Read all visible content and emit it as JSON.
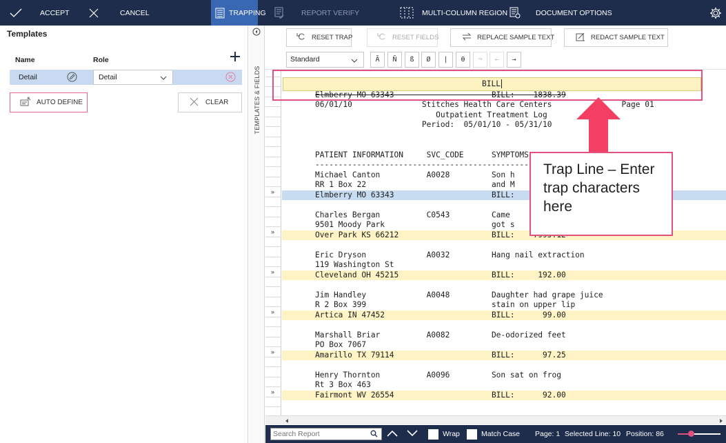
{
  "toolbar": {
    "accept": "ACCEPT",
    "cancel": "CANCEL",
    "trapping": "TRAPPING",
    "report_verify": "REPORT VERIFY",
    "multi_column": "MULTI-COLUMN REGION",
    "document_options": "DOCUMENT OPTIONS"
  },
  "templates": {
    "title": "Templates",
    "name_header": "Name",
    "role_header": "Role",
    "row": {
      "name": "Detail",
      "role": "Detail"
    },
    "auto_define": "AUTO DEFINE",
    "clear": "CLEAR",
    "side_tab": "TEMPLATES & FIELDS"
  },
  "trap_tools": {
    "reset_trap": "RESET TRAP",
    "reset_fields": "RESET FIELDS",
    "replace_sample": "REPLACE SAMPLE TEXT",
    "redact_sample": "REDACT SAMPLE TEXT",
    "font": "Standard",
    "chars": [
      "Ã",
      "Ñ",
      "ß",
      "Ø",
      "|",
      "θ",
      "¬",
      "←",
      "→"
    ]
  },
  "trap": {
    "value": "BILL",
    "tooltip": "Trap Line – Enter trap characters here"
  },
  "report": {
    "markers": [
      {
        "row": 11,
        "sym": "»"
      },
      {
        "row": 15,
        "sym": "»"
      },
      {
        "row": 19,
        "sym": "»"
      },
      {
        "row": 23,
        "sym": "»"
      },
      {
        "row": 27,
        "sym": "»"
      },
      {
        "row": 31,
        "sym": "»"
      }
    ],
    "lines": [
      {
        "row": 2,
        "text": "Elmberry MO 63343                     BILL:    1838.39",
        "strike": true
      },
      {
        "row": 3,
        "text": "06/01/10               Stitches Health Care Centers               Page 01"
      },
      {
        "row": 4,
        "text": "                          Outpatient Treatment Log"
      },
      {
        "row": 5,
        "text": "                       Period:  05/01/10 - 05/31/10"
      },
      {
        "row": 8,
        "text": "PATIENT INFORMATION     SVC_CODE      SYMPTOMS                       "
      },
      {
        "row": 9,
        "text": "------------------------------------------------------------------------"
      },
      {
        "row": 10,
        "text": "Michael Canton          A0028         Son h"
      },
      {
        "row": 11,
        "text": "RR 1 Box 22                           and M"
      },
      {
        "row": 12,
        "text": "Elmberry MO 63343                     BILL:"
      },
      {
        "row": 14,
        "text": "Charles Bergan          C0543         Came"
      },
      {
        "row": 15,
        "text": "9501 Moody Park                       got s"
      },
      {
        "row": 16,
        "text": "Over Park KS 66212                    BILL:    7995.12"
      },
      {
        "row": 18,
        "text": "Eric Dryson             A0032         Hang nail extraction"
      },
      {
        "row": 19,
        "text": "119 Washington St"
      },
      {
        "row": 20,
        "text": "Cleveland OH 45215                    BILL:     192.00"
      },
      {
        "row": 22,
        "text": "Jim Handley             A0048         Daughter had grape juice"
      },
      {
        "row": 23,
        "text": "R 2 Box 399                           stain on upper lip"
      },
      {
        "row": 24,
        "text": "Artica IN 47452                       BILL:      99.00"
      },
      {
        "row": 26,
        "text": "Marshall Briar          A0082         De-odorized feet"
      },
      {
        "row": 27,
        "text": "PO Box 7067"
      },
      {
        "row": 28,
        "text": "Amarillo TX 79114                     BILL:      97.25"
      },
      {
        "row": 30,
        "text": "Henry Thornton          A0096         Son sat on frog"
      },
      {
        "row": 31,
        "text": "Rt 3 Box 463"
      },
      {
        "row": 32,
        "text": "Fairmont WV 26554                     BILL:      92.00"
      }
    ],
    "bands": [
      {
        "row": 12,
        "kind": "sel"
      },
      {
        "row": 16,
        "kind": "bill"
      },
      {
        "row": 20,
        "kind": "bill"
      },
      {
        "row": 24,
        "kind": "bill"
      },
      {
        "row": 28,
        "kind": "bill"
      },
      {
        "row": 32,
        "kind": "bill"
      }
    ]
  },
  "status": {
    "search_placeholder": "Search Report",
    "wrap": "Wrap",
    "match_case": "Match Case",
    "page": "Page: 1",
    "selected_line": "Selected Line: 10",
    "position": "Position: 86",
    "zoom_fraction": 0.3
  },
  "colors": {
    "toolbar_bg": "#1f2d4d",
    "active_tab": "#3a67b1",
    "selection": "#c8dcf1",
    "bill_highlight": "#fdf3c4",
    "callout_border": "#e0527e",
    "arrow": "#f23f63"
  }
}
